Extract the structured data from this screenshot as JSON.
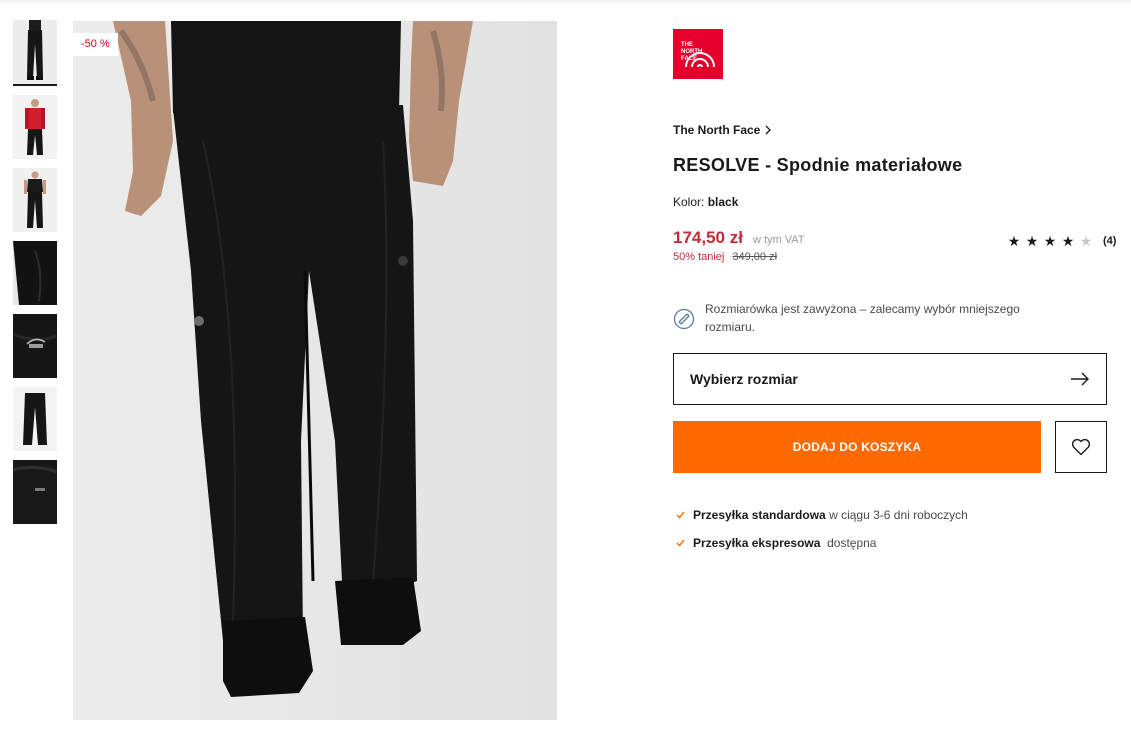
{
  "colors": {
    "accent_orange": "#ff6900",
    "price_red": "#c22c3a",
    "brand_red": "#e4002b"
  },
  "gallery": {
    "discount_badge": "-50 %",
    "thumbnail_count": 7,
    "active_thumbnail": 1
  },
  "brand": {
    "logo_text": "THE NORTH FACE",
    "name": "The North Face"
  },
  "product": {
    "title": "RESOLVE - Spodnie materiałowe",
    "color_label": "Kolor:",
    "color_value": "black"
  },
  "pricing": {
    "price": "174,50 zł",
    "vat_note": "w tym VAT",
    "discount_text": "50% taniej",
    "old_price": "349,00 zł"
  },
  "rating": {
    "stars_filled": 4,
    "stars_total": 5,
    "count": "(4)"
  },
  "size_note": {
    "text": "Rozmiarówka jest zawyżona – zalecamy wybór mniejszego rozmiaru."
  },
  "size_select": {
    "label": "Wybierz rozmiar"
  },
  "actions": {
    "add_to_cart": "DODAJ DO KOSZYKA",
    "wishlist_icon": "heart-icon"
  },
  "shipping": [
    {
      "bold": "Przesyłka standardowa",
      "text": " w ciągu 3-6 dni roboczych"
    },
    {
      "bold": "Przesyłka ekspresowa",
      "text": "  dostępna"
    }
  ]
}
